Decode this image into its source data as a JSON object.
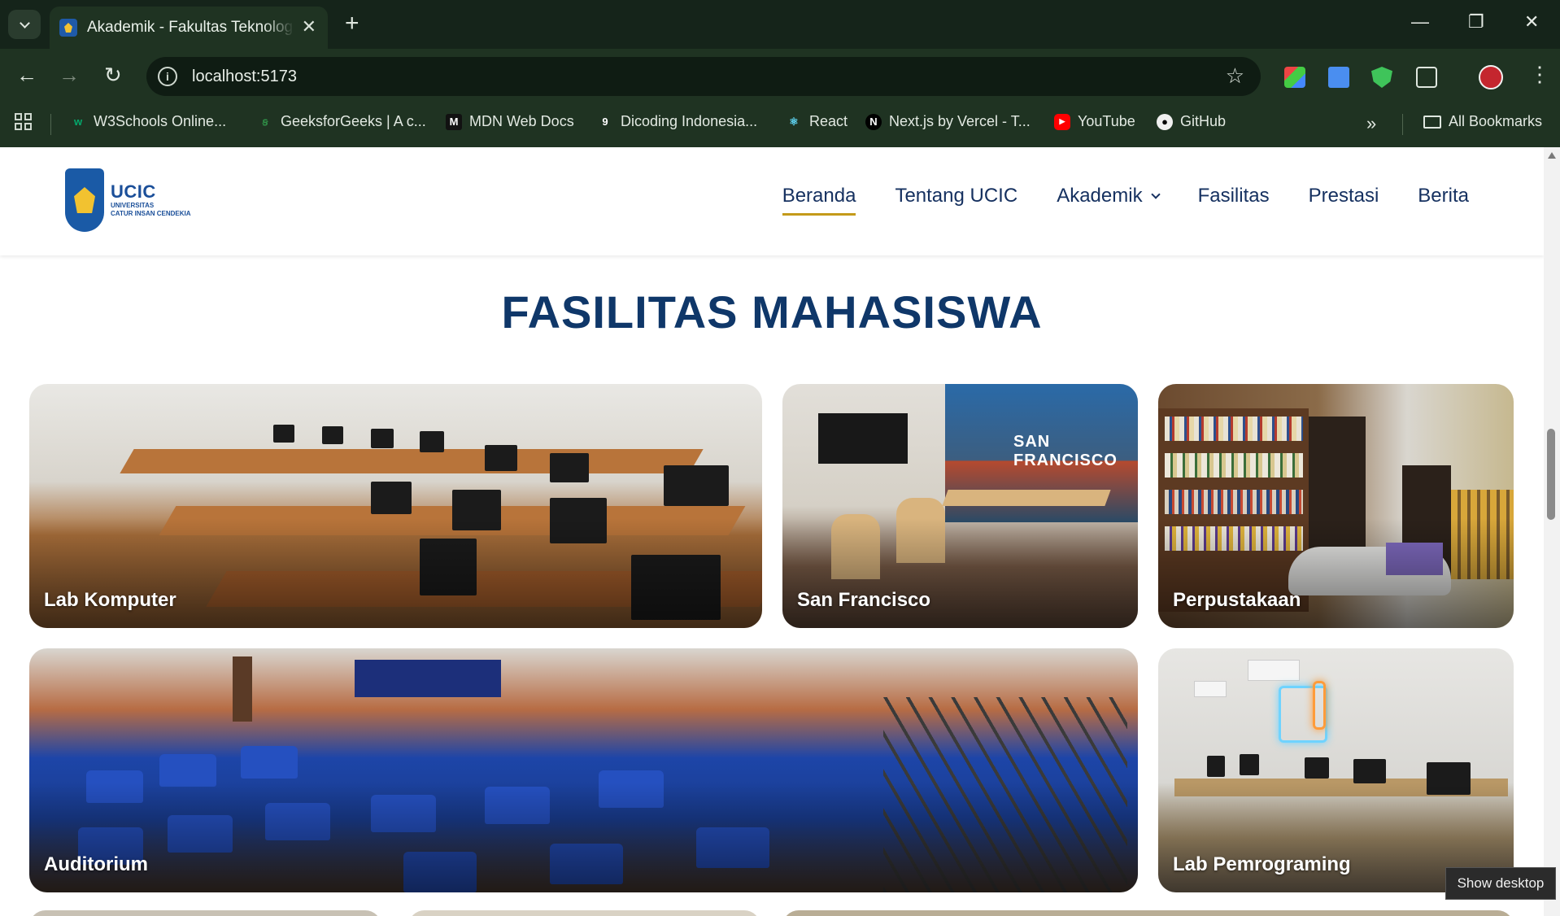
{
  "browser": {
    "tab_title": "Akademik - Fakultas Teknologi Informasi",
    "url": "localhost:5173",
    "new_tab_symbol": "+",
    "close_symbol": "✕",
    "bookmarks": [
      {
        "label": "W3Schools Online...",
        "icon": "w3schools-icon"
      },
      {
        "label": "GeeksforGeeks | A c...",
        "icon": "geeksforgeeks-icon"
      },
      {
        "label": "MDN Web Docs",
        "icon": "mdn-icon"
      },
      {
        "label": "Dicoding Indonesia...",
        "icon": "dicoding-icon"
      },
      {
        "label": "React",
        "icon": "react-icon"
      },
      {
        "label": "Next.js by Vercel - T...",
        "icon": "nextjs-icon"
      },
      {
        "label": "YouTube",
        "icon": "youtube-icon"
      },
      {
        "label": "GitHub",
        "icon": "github-icon"
      }
    ],
    "all_bookmarks_label": "All Bookmarks",
    "overflow_symbol": "»"
  },
  "site": {
    "logo_name": "UCIC",
    "logo_sub_1": "UNIVERSITAS",
    "logo_sub_2": "CATUR INSAN CENDEKIA",
    "nav": [
      {
        "label": "Beranda",
        "active": true
      },
      {
        "label": "Tentang UCIC",
        "active": false
      },
      {
        "label": "Akademik",
        "active": false,
        "dropdown": true
      },
      {
        "label": "Fasilitas",
        "active": false
      },
      {
        "label": "Prestasi",
        "active": false
      },
      {
        "label": "Berita",
        "active": false
      }
    ]
  },
  "section": {
    "title": "FASILITAS MAHASISWA",
    "cards": [
      {
        "label": "Lab Komputer"
      },
      {
        "label": "San Francisco"
      },
      {
        "label": "Perpustakaan"
      },
      {
        "label": "Auditorium"
      },
      {
        "label": "Lab Pemrograming"
      }
    ],
    "sf_wall_text": "SAN FRANCISCO"
  },
  "tooltip": "Show desktop",
  "colors": {
    "chrome_bg": "#1f3322",
    "heading": "#0f3769",
    "nav_text": "#163160",
    "active_underline": "#c49a1a"
  }
}
